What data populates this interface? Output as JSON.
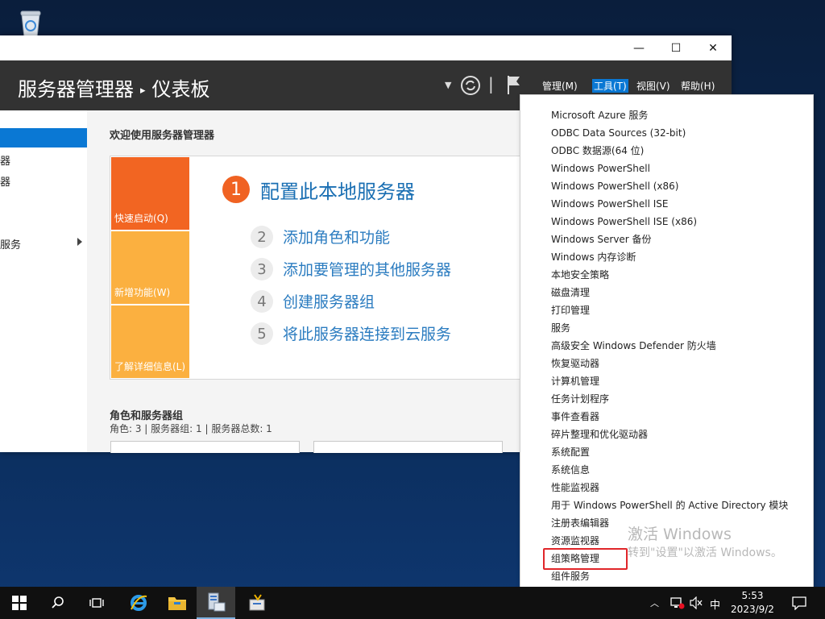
{
  "window": {
    "title_path": [
      "服务器管理器",
      "仪表板"
    ],
    "controls": {
      "minimize": "—",
      "maximize": "☐",
      "close": "✕"
    },
    "menus": [
      "管理(M)",
      "工具(T)",
      "视图(V)",
      "帮助(H)"
    ],
    "active_menu_index": 1
  },
  "sidebar": {
    "items": [
      "",
      "器",
      "器",
      "服务"
    ]
  },
  "main": {
    "welcome": "欢迎使用服务器管理器",
    "tiles": [
      {
        "label": "快速启动(Q)",
        "color": "#f26522"
      },
      {
        "label": "新增功能(W)",
        "color": "#fbb040"
      },
      {
        "label": "了解详细信息(L)",
        "color": "#fbb040"
      }
    ],
    "step1": {
      "num": "1",
      "text": "配置此本地服务器"
    },
    "steps": [
      {
        "num": "2",
        "text": "添加角色和功能"
      },
      {
        "num": "3",
        "text": "添加要管理的其他服务器"
      },
      {
        "num": "4",
        "text": "创建服务器组"
      },
      {
        "num": "5",
        "text": "将此服务器连接到云服务"
      }
    ],
    "roles_title": "角色和服务器组",
    "roles_summary": "角色: 3 | 服务器组: 1 | 服务器总数: 1"
  },
  "tools_menu": {
    "items": [
      "Microsoft Azure 服务",
      "ODBC Data Sources (32-bit)",
      "ODBC 数据源(64 位)",
      "Windows PowerShell",
      "Windows PowerShell (x86)",
      "Windows PowerShell ISE",
      "Windows PowerShell ISE (x86)",
      "Windows Server 备份",
      "Windows 内存诊断",
      "本地安全策略",
      "磁盘清理",
      "打印管理",
      "服务",
      "高级安全 Windows Defender 防火墙",
      "恢复驱动器",
      "计算机管理",
      "任务计划程序",
      "事件查看器",
      "碎片整理和优化驱动器",
      "系统配置",
      "系统信息",
      "性能监视器",
      "用于 Windows PowerShell 的 Active Directory 模块",
      "注册表编辑器",
      "资源监视器",
      "组策略管理",
      "组件服务"
    ],
    "highlighted": "组策略管理",
    "highlight_color": "#e0262a"
  },
  "watermark": {
    "line1": "激活 Windows",
    "line2": "转到\"设置\"以激活 Windows。"
  },
  "taskbar": {
    "icons": [
      "windows-start-icon",
      "search-icon",
      "task-view-icon",
      "internet-explorer-icon",
      "file-explorer-icon",
      "server-manager-icon",
      "tools-icon"
    ],
    "ime": "中",
    "time": "5:53",
    "date": "2023/9/2"
  },
  "colors": {
    "accent": "#0a78d4",
    "header_bg": "#323232",
    "link": "#2b7cc0"
  }
}
